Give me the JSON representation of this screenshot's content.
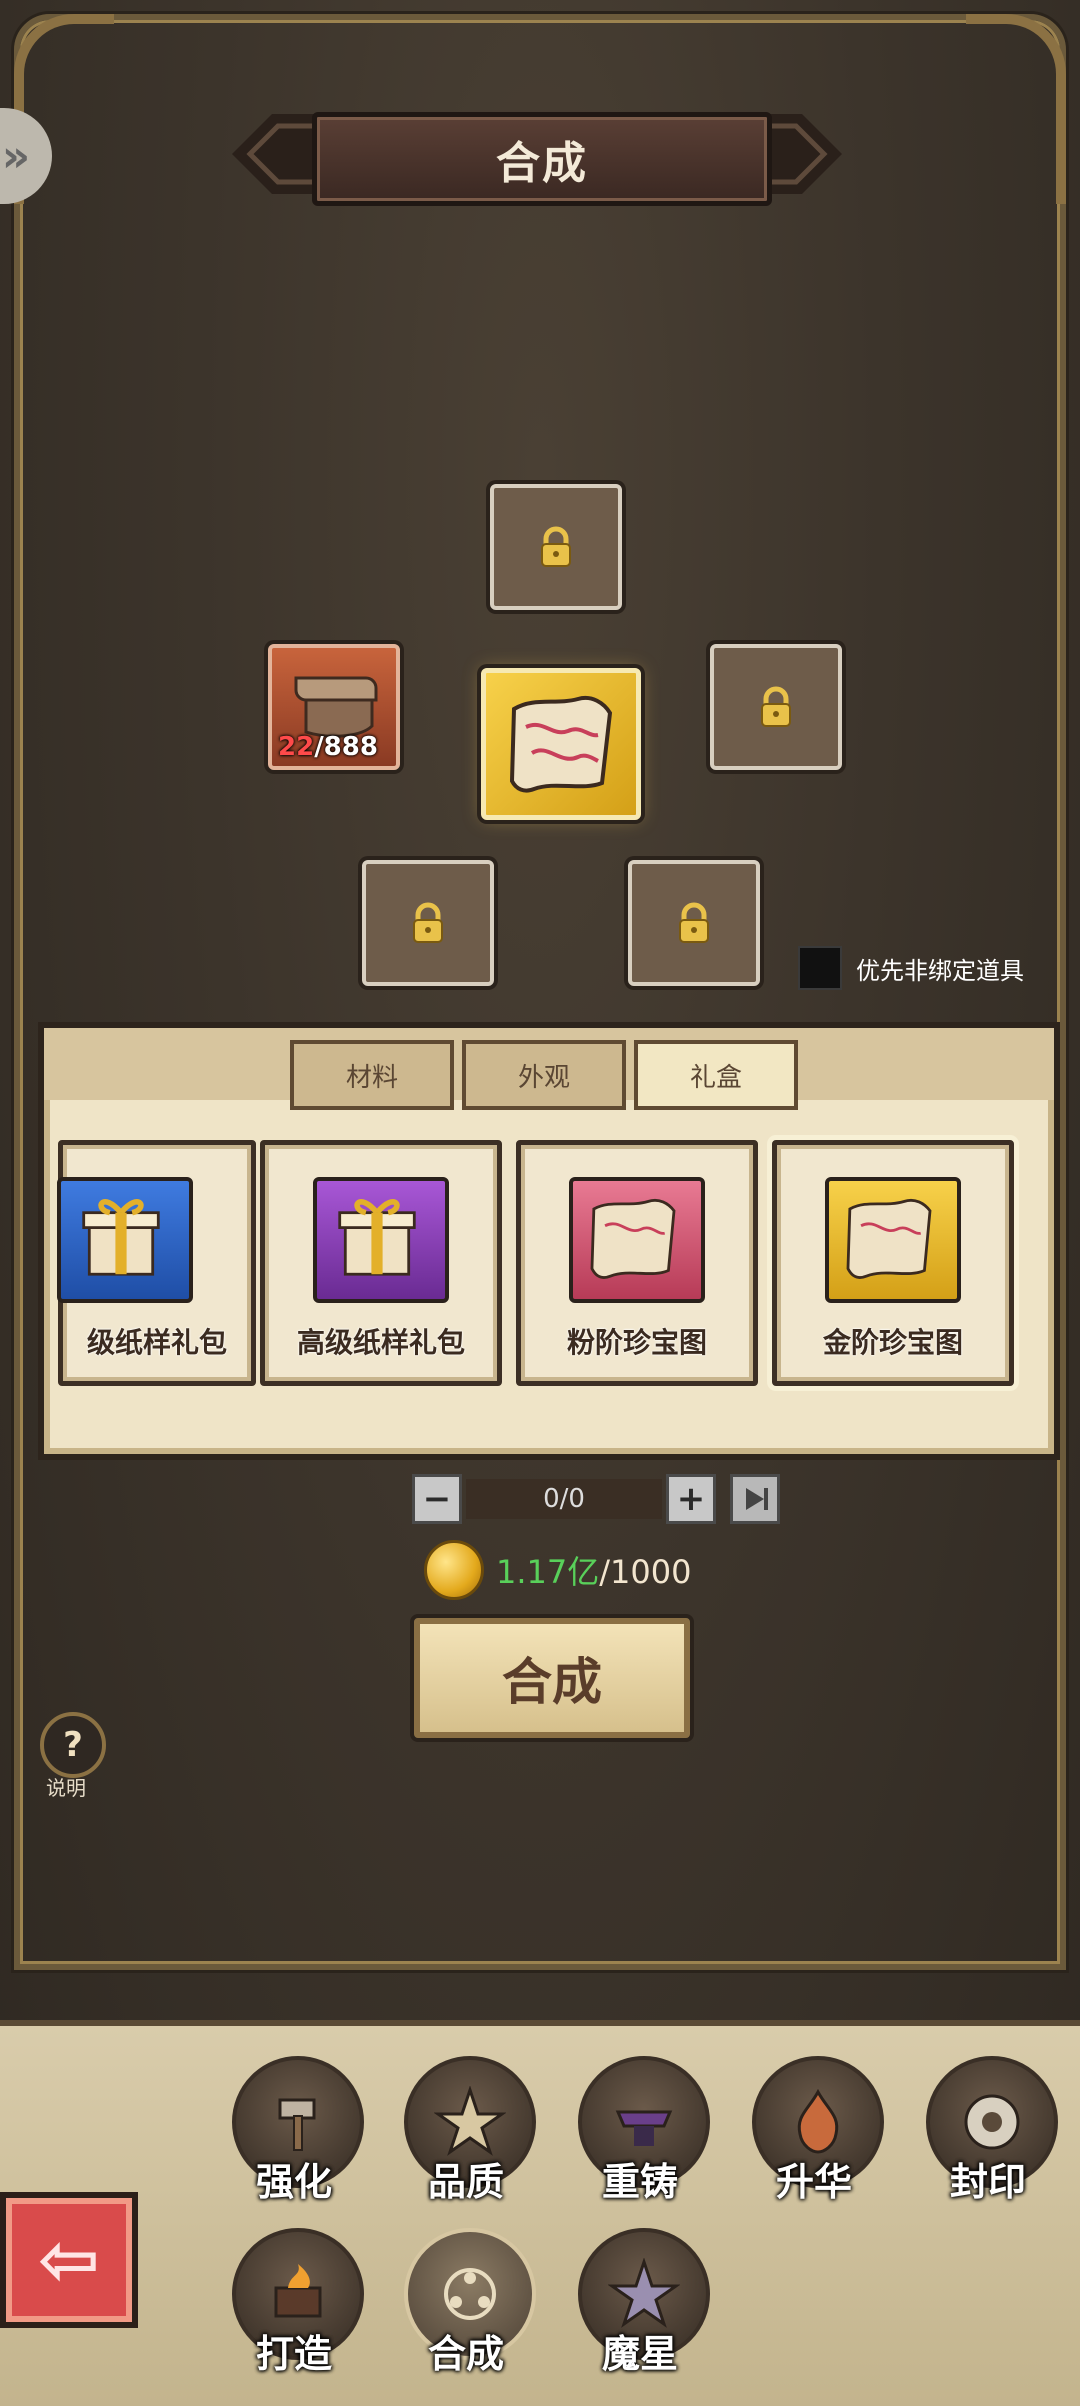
{
  "header": {
    "title": "合成"
  },
  "slots": {
    "material_count_current": "22",
    "material_count_max": "/888"
  },
  "prefer_option": {
    "label": "优先非绑定道具",
    "checked": false
  },
  "tabs": [
    {
      "label": "材料",
      "active": false
    },
    {
      "label": "外观",
      "active": false
    },
    {
      "label": "礼盒",
      "active": true
    }
  ],
  "items": [
    {
      "label": "级纸样礼包",
      "color": "#2f6bd1",
      "icon": "gift-box-icon"
    },
    {
      "label": "高级纸样礼包",
      "color": "#8a3fb7",
      "icon": "gift-box-icon"
    },
    {
      "label": "粉阶珍宝图",
      "color": "#d7516f",
      "icon": "treasure-map-icon"
    },
    {
      "label": "金阶珍宝图",
      "color": "#e0a923",
      "icon": "treasure-map-icon"
    }
  ],
  "quantity": {
    "value": "0/0"
  },
  "cost": {
    "have": "1.17亿",
    "need": "/1000"
  },
  "synthesize_button": "合成",
  "help": {
    "label": "说明"
  },
  "nav": [
    {
      "label": "强化",
      "icon": "hammer-icon"
    },
    {
      "label": "品质",
      "icon": "star-icon"
    },
    {
      "label": "重铸",
      "icon": "anvil-icon"
    },
    {
      "label": "升华",
      "icon": "flame-icon"
    },
    {
      "label": "封印",
      "icon": "seal-icon"
    },
    {
      "label": "打造",
      "icon": "forge-icon"
    },
    {
      "label": "合成",
      "icon": "synthesis-icon",
      "active": true
    },
    {
      "label": "魔星",
      "icon": "magic-star-icon"
    }
  ],
  "colors": {
    "accent_gold": "#e0a923",
    "panel_bg": "#efe4c7",
    "frame": "#8b7143"
  }
}
